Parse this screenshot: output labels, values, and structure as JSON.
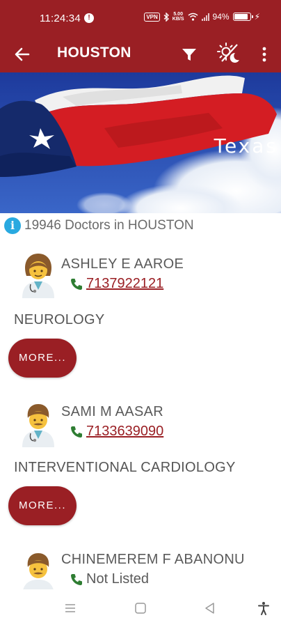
{
  "status_bar": {
    "time": "11:24:34",
    "vpn": "VPN",
    "speed_top": "5.00",
    "speed_bottom": "KB/S",
    "battery": "94%",
    "battery_level": 0.94
  },
  "app_bar": {
    "title": "HOUSTON"
  },
  "banner": {
    "text": "Texas"
  },
  "summary": {
    "count_text": "19946 Doctors in HOUSTON"
  },
  "doctors": [
    {
      "name": "ASHLEY E AAROE",
      "phone": "7137922121",
      "specialty": "NEUROLOGY",
      "more_label": "MORE..."
    },
    {
      "name": "SAMI M AASAR",
      "phone": "7133639090",
      "specialty": "INTERVENTIONAL CARDIOLOGY",
      "more_label": "MORE..."
    },
    {
      "name": "CHINEMEREM F ABANONU",
      "phone": "Not Listed"
    }
  ],
  "colors": {
    "primary": "#9a1f24",
    "info": "#29a9e0",
    "phone_icon": "#2e7d32"
  }
}
